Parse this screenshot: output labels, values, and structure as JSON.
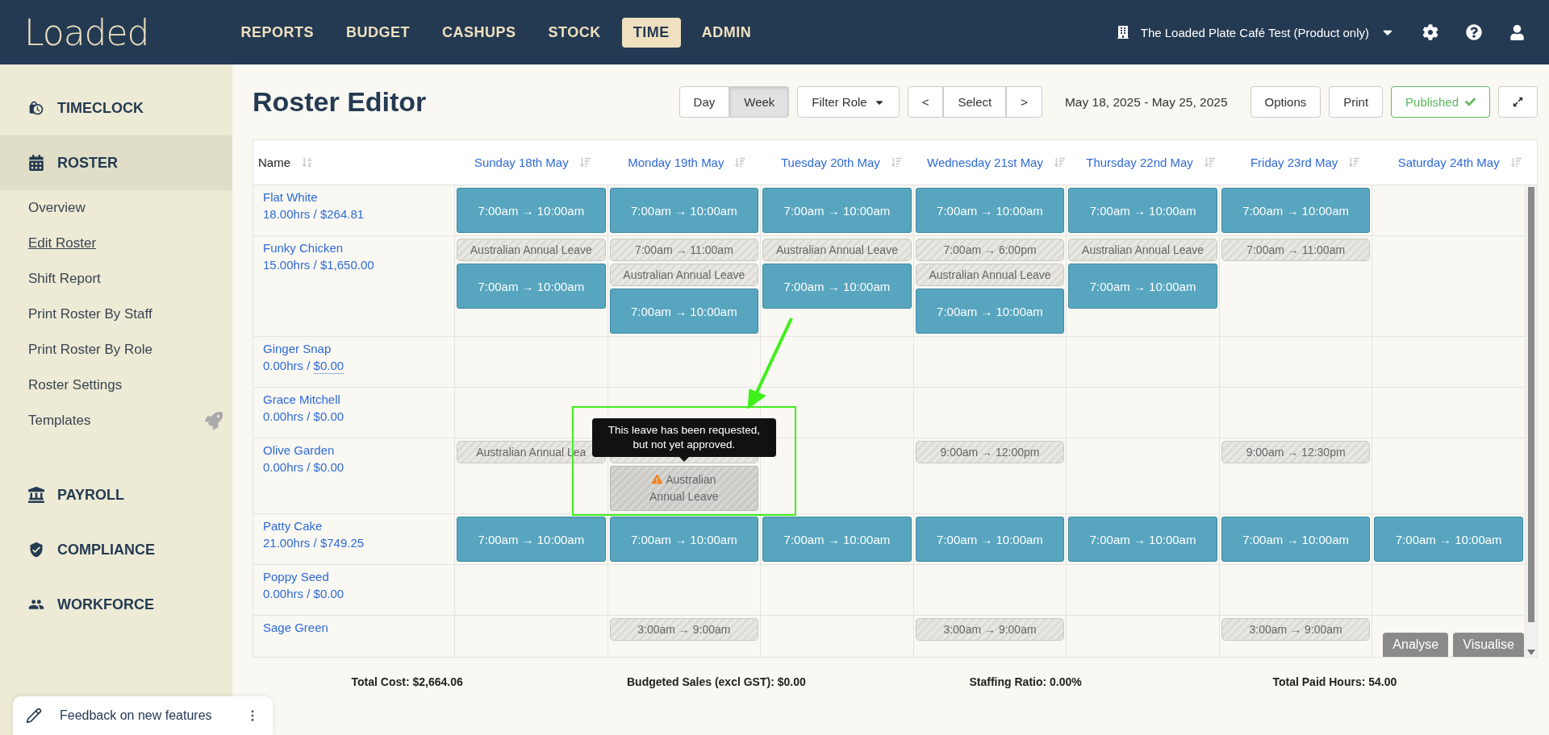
{
  "header": {
    "logo": "Loaded",
    "nav": [
      {
        "label": "REPORTS",
        "selected": false
      },
      {
        "label": "BUDGET",
        "selected": false
      },
      {
        "label": "CASHUPS",
        "selected": false
      },
      {
        "label": "STOCK",
        "selected": false
      },
      {
        "label": "TIME",
        "selected": true
      },
      {
        "label": "ADMIN",
        "selected": false
      }
    ],
    "venue": "The Loaded Plate Café Test (Product only)"
  },
  "sidebar": {
    "sections": [
      {
        "label": "TIMECLOCK",
        "selected": false
      },
      {
        "label": "ROSTER",
        "selected": true,
        "children": [
          {
            "label": "Overview",
            "selected": false,
            "rocket": false
          },
          {
            "label": "Edit Roster",
            "selected": true,
            "rocket": false
          },
          {
            "label": "Shift Report",
            "selected": false,
            "rocket": false
          },
          {
            "label": "Print Roster By Staff",
            "selected": false,
            "rocket": false
          },
          {
            "label": "Print Roster By Role",
            "selected": false,
            "rocket": false
          },
          {
            "label": "Roster Settings",
            "selected": false,
            "rocket": false
          },
          {
            "label": "Templates",
            "selected": false,
            "rocket": true
          }
        ]
      },
      {
        "label": "PAYROLL",
        "selected": false
      },
      {
        "label": "COMPLIANCE",
        "selected": false
      },
      {
        "label": "WORKFORCE",
        "selected": false
      }
    ],
    "feedback": "Feedback on new features"
  },
  "page": {
    "title": "Roster Editor",
    "views": [
      {
        "label": "Day",
        "selected": false
      },
      {
        "label": "Week",
        "selected": true
      }
    ],
    "filter": "Filter Role",
    "prev": "<",
    "select": "Select",
    "next": ">",
    "date_range": "May 18, 2025 - May 25, 2025",
    "options": "Options",
    "print": "Print",
    "status": {
      "label": "Published",
      "published": true
    }
  },
  "table": {
    "name_column": "Name",
    "days": [
      "Sunday 18th May",
      "Monday 19th May",
      "Tuesday 20th May",
      "Wednesday 21st May",
      "Thursday 22nd May",
      "Friday 23rd May",
      "Saturday 24th May"
    ],
    "rows": [
      {
        "name": "Flat White",
        "hours": "18.00hrs / ",
        "cost": "$264.81",
        "dotted": false,
        "cells": [
          [
            {
              "kind": "shift",
              "text": "7:00am → 10:00am"
            }
          ],
          [
            {
              "kind": "shift",
              "text": "7:00am → 10:00am"
            }
          ],
          [
            {
              "kind": "shift",
              "text": "7:00am → 10:00am"
            }
          ],
          [
            {
              "kind": "shift",
              "text": "7:00am → 10:00am"
            }
          ],
          [
            {
              "kind": "shift",
              "text": "7:00am → 10:00am"
            }
          ],
          [
            {
              "kind": "shift",
              "text": "7:00am → 10:00am"
            }
          ],
          []
        ]
      },
      {
        "name": "Funky Chicken",
        "hours": "15.00hrs / ",
        "cost": "$1,650.00",
        "dotted": false,
        "cells": [
          [
            {
              "kind": "leave",
              "text": "Australian Annual Leave"
            },
            {
              "kind": "shift",
              "text": "7:00am → 10:00am"
            }
          ],
          [
            {
              "kind": "leave",
              "text": "7:00am → 11:00am"
            },
            {
              "kind": "leave",
              "text": "Australian Annual Leave"
            },
            {
              "kind": "shift",
              "text": "7:00am → 10:00am"
            }
          ],
          [
            {
              "kind": "leave",
              "text": "Australian Annual Leave"
            },
            {
              "kind": "shift",
              "text": "7:00am → 10:00am"
            }
          ],
          [
            {
              "kind": "leave",
              "text": "7:00am → 6:00pm"
            },
            {
              "kind": "leave",
              "text": "Australian Annual Leave"
            },
            {
              "kind": "shift",
              "text": "7:00am → 10:00am"
            }
          ],
          [
            {
              "kind": "leave",
              "text": "Australian Annual Leave"
            },
            {
              "kind": "shift",
              "text": "7:00am → 10:00am"
            }
          ],
          [
            {
              "kind": "leave",
              "text": "7:00am → 11:00am"
            }
          ],
          []
        ]
      },
      {
        "name": "Ginger Snap",
        "hours": "0.00hrs / ",
        "cost": "$0.00",
        "dotted": true,
        "cells": [
          [],
          [],
          [],
          [],
          [],
          [],
          []
        ]
      },
      {
        "name": "Grace Mitchell",
        "hours": "0.00hrs / ",
        "cost": "$0.00",
        "dotted": false,
        "cells": [
          [],
          [],
          [],
          [],
          [],
          [],
          []
        ]
      },
      {
        "name": "Olive Garden",
        "hours": "0.00hrs / ",
        "cost": "$0.00",
        "dotted": false,
        "cells": [
          [
            {
              "kind": "leave",
              "text": "Australian Annual Lea"
            }
          ],
          [
            {
              "kind": "leave"
            },
            {
              "kind": "pending",
              "text": "Australian Annual Leave",
              "tooltip": "This leave has been requested, but not yet approved."
            }
          ],
          [],
          [
            {
              "kind": "leave",
              "text": "9:00am → 12:00pm"
            }
          ],
          [],
          [
            {
              "kind": "leave",
              "text": "9:00am → 12:30pm"
            }
          ],
          []
        ]
      },
      {
        "name": "Patty Cake",
        "hours": "21.00hrs / ",
        "cost": "$749.25",
        "dotted": false,
        "cells": [
          [
            {
              "kind": "shift",
              "text": "7:00am → 10:00am"
            }
          ],
          [
            {
              "kind": "shift",
              "text": "7:00am → 10:00am"
            }
          ],
          [
            {
              "kind": "shift",
              "text": "7:00am → 10:00am"
            }
          ],
          [
            {
              "kind": "shift",
              "text": "7:00am → 10:00am"
            }
          ],
          [
            {
              "kind": "shift",
              "text": "7:00am → 10:00am"
            }
          ],
          [
            {
              "kind": "shift",
              "text": "7:00am → 10:00am"
            }
          ],
          [
            {
              "kind": "shift",
              "text": "7:00am → 10:00am"
            }
          ]
        ]
      },
      {
        "name": "Poppy Seed",
        "hours": "0.00hrs / ",
        "cost": "$0.00",
        "dotted": false,
        "cells": [
          [],
          [],
          [],
          [],
          [],
          [],
          []
        ]
      },
      {
        "name": "Sage Green",
        "cells": [
          [],
          [
            {
              "kind": "leave",
              "text": "3:00am → 9:00am"
            }
          ],
          [],
          [
            {
              "kind": "leave",
              "text": "3:00am → 9:00am"
            }
          ],
          [],
          [
            {
              "kind": "leave",
              "text": "3:00am → 9:00am"
            }
          ],
          []
        ]
      }
    ],
    "actions": [
      "Analyse",
      "Visualise"
    ]
  },
  "totals": [
    "Total Cost: $2,664.06",
    "Budgeted Sales (excl GST): $0.00",
    "Staffing Ratio: 0.00%",
    "Total Paid Hours: 54.00"
  ]
}
